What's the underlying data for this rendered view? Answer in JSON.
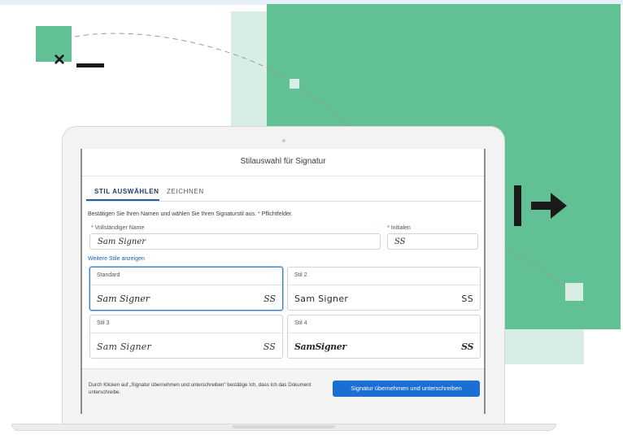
{
  "colors": {
    "brand_green": "#62c095",
    "light_green": "#d8eee4",
    "accent_blue": "#1b6fd4",
    "dark": "#1a1a1a"
  },
  "dialog": {
    "title": "Stilauswahl für Signatur",
    "tabs": [
      {
        "label": "STIL AUSWÄHLEN",
        "active": true
      },
      {
        "label": "ZEICHNEN",
        "active": false
      }
    ],
    "instructions": "Bestätigen Sie Ihren Namen und wählen Sie Ihren Signaturstil aus.",
    "required_marker": "*",
    "required_note": "Pflichtfelder.",
    "full_name_label": "Vollständiger Name",
    "full_name_value": "Sam Signer",
    "initials_label": "Initialen",
    "initials_value": "SS",
    "more_styles_link": "Weitere Stile anzeigen",
    "styles": [
      {
        "label": "Standard",
        "signature": "Sam Signer",
        "initials": "SS",
        "selected": true
      },
      {
        "label": "Stil 2",
        "signature": "Sam Signer",
        "initials": "SS",
        "selected": false
      },
      {
        "label": "Stil 3",
        "signature": "Sam Signer",
        "initials": "SS",
        "selected": false
      },
      {
        "label": "Stil 4",
        "signature": "SamSigner",
        "initials": "SS",
        "selected": false
      }
    ],
    "consent_text": "Durch Klicken auf „Signatur übernehmen und unterschreiben“ bestätige Ich, dass Ich das Dokument unterschreibe.",
    "submit_label": "Signatur übernehmen und unterschreiben"
  },
  "icons": {
    "cross": "×",
    "sign_arrow": "arrow-right-icon"
  }
}
